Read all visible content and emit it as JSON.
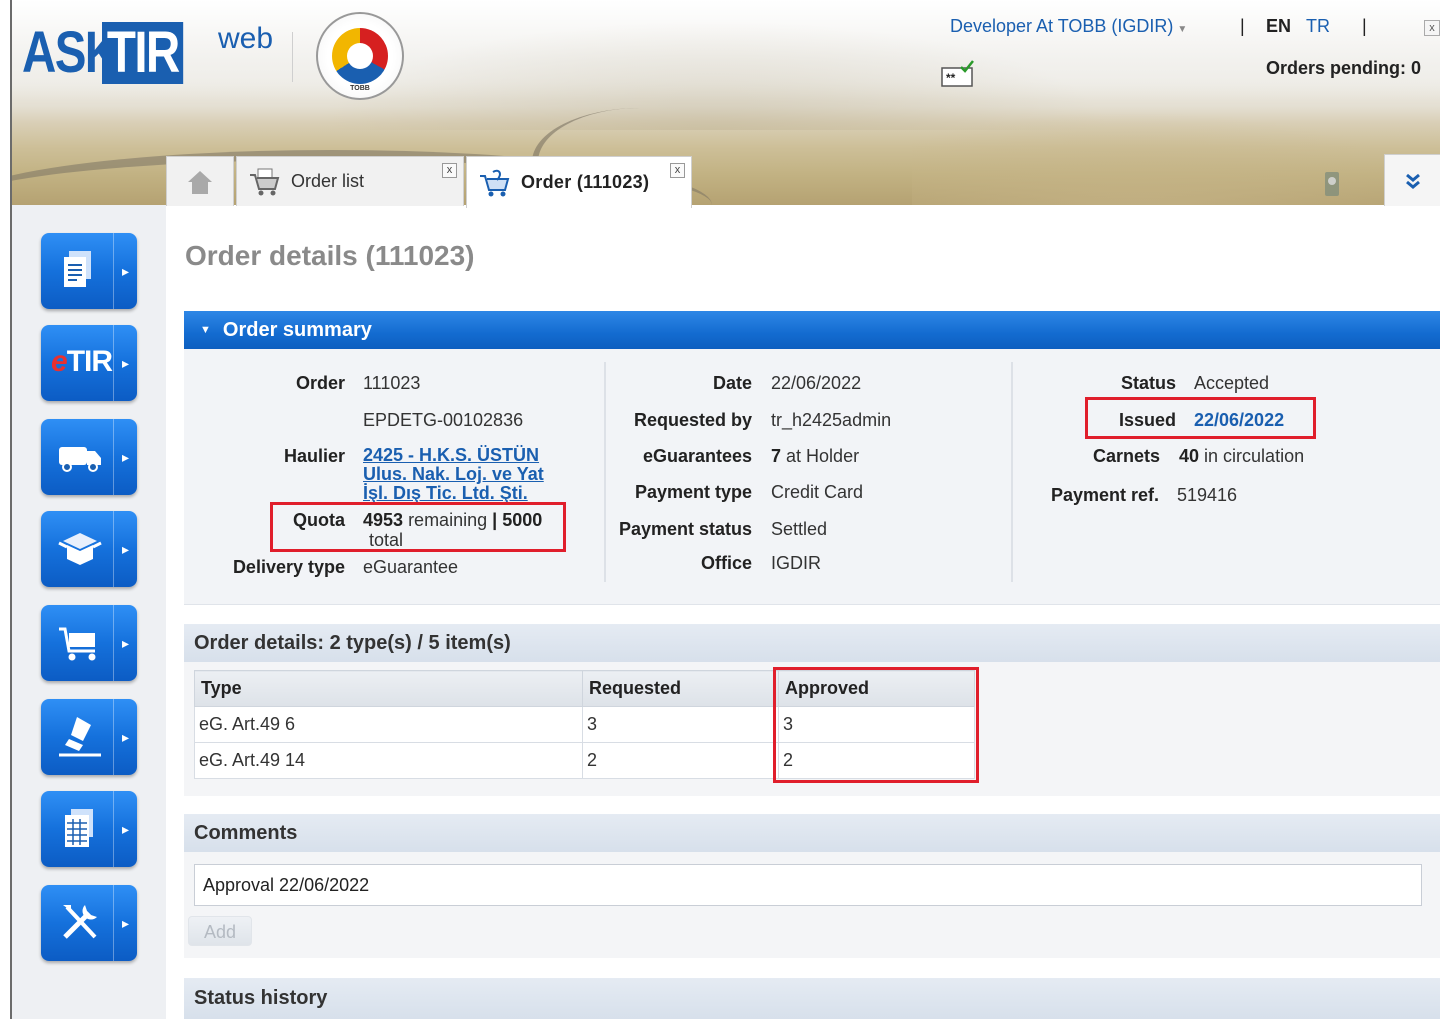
{
  "header": {
    "logo": {
      "ask": "ASK",
      "tir": "TIR",
      "web": "web",
      "seal_text": "TOBB"
    },
    "user_menu": "Developer At TOBB (IGDIR)",
    "separator": "|",
    "lang_en": "EN",
    "lang_tr": "TR",
    "close": "x",
    "orders_pending": "Orders pending: 0"
  },
  "tabs": [
    {
      "label": "",
      "icon": "home-icon",
      "active": false
    },
    {
      "label": "Order list",
      "icon": "cart-list-icon",
      "active": false,
      "close": "x"
    },
    {
      "label": "Order (111023)",
      "icon": "cart-order-icon",
      "active": true,
      "close": "x"
    }
  ],
  "expand_icon": "double-chevron-down-icon",
  "sidebar": {
    "items": [
      {
        "icon": "documents-icon",
        "label": ""
      },
      {
        "icon": "etir-icon",
        "label": "eTIR",
        "label_e": "e",
        "label_tir": "TIR"
      },
      {
        "icon": "truck-icon",
        "label": ""
      },
      {
        "icon": "package-icon",
        "label": ""
      },
      {
        "icon": "cart-icon",
        "label": ""
      },
      {
        "icon": "stamp-icon",
        "label": ""
      },
      {
        "icon": "report-table-icon",
        "label": ""
      },
      {
        "icon": "tools-icon",
        "label": ""
      }
    ],
    "arrow": "▸"
  },
  "page_title": "Order details (111023)",
  "order_summary": {
    "title": "Order summary",
    "col1": {
      "order_label": "Order",
      "order_value": "111023",
      "order_ref": "EPDETG-00102836",
      "haulier_label": "Haulier",
      "haulier_line1": "2425 - H.K.S. ÜSTÜN",
      "haulier_line2": "Ulus. Nak. Loj. ve Yat",
      "haulier_line3": "İşl. Dış Tic. Ltd. Şti.",
      "quota_label": "Quota",
      "quota_remaining": "4953",
      "quota_remaining_text": "remaining",
      "quota_sep": "|",
      "quota_total": "5000",
      "quota_total_text": "total",
      "delivery_label": "Delivery type",
      "delivery_value": "eGuarantee"
    },
    "col2": {
      "date_label": "Date",
      "date_value": "22/06/2022",
      "requested_by_label": "Requested by",
      "requested_by_value": "tr_h2425admin",
      "eguarantees_label": "eGuarantees",
      "eguarantees_count": "7",
      "eguarantees_text": "at Holder",
      "payment_type_label": "Payment type",
      "payment_type_value": "Credit Card",
      "payment_status_label": "Payment status",
      "payment_status_value": "Settled",
      "office_label": "Office",
      "office_value": "IGDIR"
    },
    "col3": {
      "status_label": "Status",
      "status_value": "Accepted",
      "issued_label": "Issued",
      "issued_value": "22/06/2022",
      "carnets_label": "Carnets",
      "carnets_count": "40",
      "carnets_text": "in circulation",
      "payment_ref_label": "Payment ref.",
      "payment_ref_value": "519416"
    }
  },
  "order_details": {
    "title": "Order details:  2 type(s) / 5 item(s)",
    "columns": [
      "Type",
      "Requested",
      "Approved"
    ],
    "rows": [
      [
        "eG. Art.49 6",
        "3",
        "3"
      ],
      [
        "eG. Art.49 14",
        "2",
        "2"
      ]
    ]
  },
  "comments": {
    "title": "Comments",
    "value": "Approval 22/06/2022",
    "add_label": "Add"
  },
  "status_history": {
    "title": "Status history"
  },
  "colors": {
    "accent": "#1a5fb0",
    "highlight": "#e01e2b",
    "section_blue": "#136bd0"
  }
}
